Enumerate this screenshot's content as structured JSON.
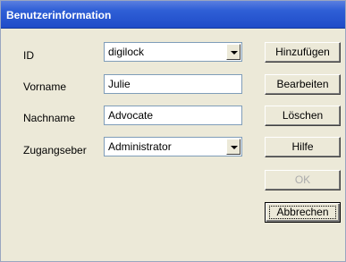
{
  "window": {
    "title": "Benutzerinformation"
  },
  "form": {
    "id": {
      "label": "ID",
      "value": "digilock"
    },
    "vorname": {
      "label": "Vorname",
      "value": "Julie"
    },
    "nachname": {
      "label": "Nachname",
      "value": "Advocate"
    },
    "zugangseber": {
      "label": "Zugangseber",
      "value": "Administrator"
    }
  },
  "buttons": {
    "hinzufuegen": "Hinzufügen",
    "bearbeiten": "Bearbeiten",
    "loeschen": "Löschen",
    "hilfe": "Hilfe",
    "ok": "OK",
    "abbrechen": "Abbrechen"
  }
}
